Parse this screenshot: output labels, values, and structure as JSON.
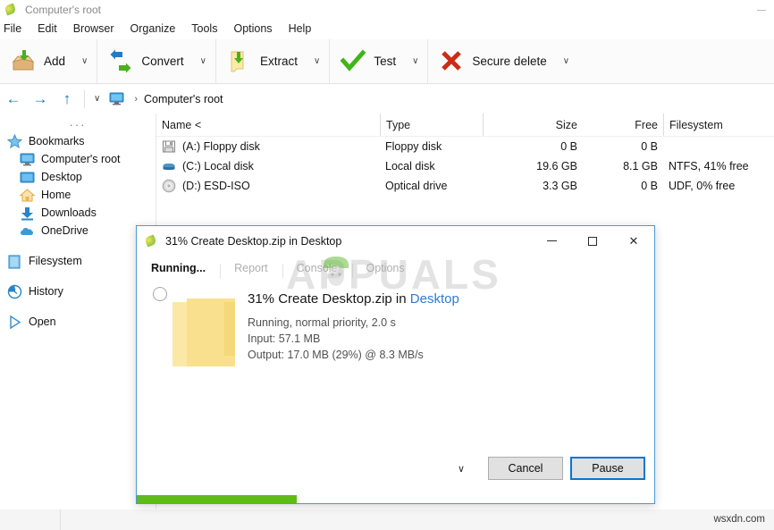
{
  "window": {
    "title": "Computer's root",
    "app_icon": "peazip-icon",
    "minimize_label": "–"
  },
  "menubar": {
    "items": [
      {
        "label": "File",
        "name": "menu-file"
      },
      {
        "label": "Edit",
        "name": "menu-edit"
      },
      {
        "label": "Browser",
        "name": "menu-browser"
      },
      {
        "label": "Organize",
        "name": "menu-organize"
      },
      {
        "label": "Tools",
        "name": "menu-tools"
      },
      {
        "label": "Options",
        "name": "menu-options"
      },
      {
        "label": "Help",
        "name": "menu-help"
      }
    ]
  },
  "toolbar": {
    "caret": "∨",
    "buttons": [
      {
        "label": "Add",
        "icon": "add-box-icon",
        "name": "toolbar-add"
      },
      {
        "label": "Convert",
        "icon": "convert-arrows-icon",
        "name": "toolbar-convert"
      },
      {
        "label": "Extract",
        "icon": "extract-folder-icon",
        "name": "toolbar-extract"
      },
      {
        "label": "Test",
        "icon": "checkmark-icon",
        "name": "toolbar-test"
      },
      {
        "label": "Secure delete",
        "icon": "red-x-icon",
        "name": "toolbar-secure-delete"
      }
    ]
  },
  "navbar": {
    "back": "←",
    "forward": "→",
    "up": "↑",
    "dropdown_caret": "∨",
    "separator": "›",
    "path": "Computer's root"
  },
  "sidebar": {
    "dots": "···",
    "items": [
      {
        "label": "Bookmarks",
        "icon": "star-icon",
        "indent": false,
        "spaced": false
      },
      {
        "label": "Computer's root",
        "icon": "monitor-icon",
        "indent": true,
        "spaced": false
      },
      {
        "label": "Desktop",
        "icon": "desktop-icon",
        "indent": true,
        "spaced": false
      },
      {
        "label": "Home",
        "icon": "home-icon",
        "indent": true,
        "spaced": false
      },
      {
        "label": "Downloads",
        "icon": "download-icon",
        "indent": true,
        "spaced": false
      },
      {
        "label": "OneDrive",
        "icon": "cloud-icon",
        "indent": true,
        "spaced": false
      },
      {
        "label": "Filesystem",
        "icon": "drive-icon",
        "indent": false,
        "spaced": true
      },
      {
        "label": "History",
        "icon": "clock-icon",
        "indent": false,
        "spaced": true
      },
      {
        "label": "Open",
        "icon": "play-icon",
        "indent": false,
        "spaced": true
      }
    ]
  },
  "filelist": {
    "columns": [
      {
        "label": "Name <",
        "key": "name"
      },
      {
        "label": "Type",
        "key": "type"
      },
      {
        "label": "Size",
        "key": "size"
      },
      {
        "label": "Free",
        "key": "free"
      },
      {
        "label": "Filesystem",
        "key": "filesystem"
      }
    ],
    "rows": [
      {
        "icon": "floppy-disk-icon",
        "name": "(A:) Floppy disk",
        "type": "Floppy disk",
        "size": "0 B",
        "free": "0 B",
        "filesystem": ""
      },
      {
        "icon": "hard-disk-icon",
        "name": "(C:) Local disk",
        "type": "Local disk",
        "size": "19.6 GB",
        "free": "8.1 GB",
        "filesystem": "NTFS, 41% free"
      },
      {
        "icon": "optical-disc-icon",
        "name": "(D:) ESD-ISO",
        "type": "Optical drive",
        "size": "3.3 GB",
        "free": "0 B",
        "filesystem": "UDF, 0% free"
      }
    ]
  },
  "dialog": {
    "icon": "peazip-icon",
    "title": "31% Create Desktop.zip in Desktop",
    "minimize": "–",
    "maximize": "□",
    "close": "✕",
    "tabs": [
      {
        "label": "Running...",
        "active": true,
        "name": "tab-running"
      },
      {
        "label": "Report",
        "active": false,
        "name": "tab-report"
      },
      {
        "label": "Console",
        "active": false,
        "name": "tab-console"
      },
      {
        "label": "Options",
        "active": false,
        "name": "tab-options"
      }
    ],
    "job": {
      "headline_prefix": "31% Create Desktop.zip in ",
      "headline_destination": "Desktop",
      "status": "Running, normal priority, 2.0 s",
      "input": "Input: 57.1 MB",
      "output": "Output: 17.0 MB (29%) @ 8.3 MB/s",
      "progress_percent": 31,
      "progress_color": "#5fbb17"
    },
    "footer": {
      "caret": "∨",
      "cancel_label": "Cancel",
      "pause_label": "Pause"
    }
  },
  "watermarks": {
    "overlay": "APPUALS",
    "site": "wsxdn.com"
  },
  "colors": {
    "accent_blue": "#0078d7",
    "dialog_border": "#4a9bd1",
    "progress_green": "#5fbb17",
    "link_blue": "#2b7cd3"
  }
}
